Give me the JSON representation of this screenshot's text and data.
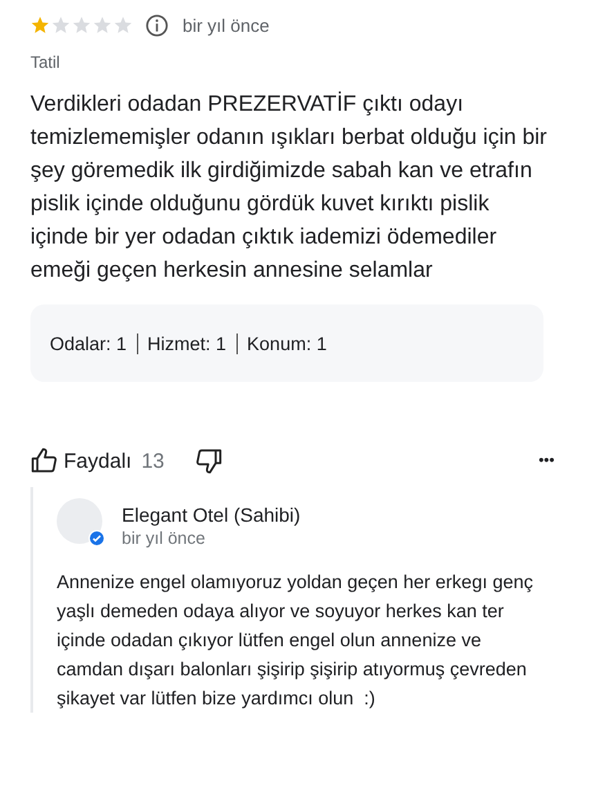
{
  "review": {
    "stars": 1,
    "time": "bir yıl önce",
    "trip_type": "Tatil",
    "text": "Verdikleri odadan PREZERVATİF çıktı odayı temizlememişler odanın ışıkları berbat olduğu için bir şey göremedik ilk girdiğimizde sabah kan ve etrafın pislik içinde olduğunu gördük kuvet kırıktı pislik içinde bir yer odadan çıktık iademizi ödemediler emeği geçen herkesin annesine selamlar",
    "ratings": [
      "Odalar: 1",
      "Hizmet: 1",
      "Konum: 1"
    ]
  },
  "actions": {
    "helpful_label": "Faydalı",
    "helpful_count": "13",
    "more": "•••"
  },
  "reply": {
    "author": "Elegant Otel (Sahibi)",
    "verified": true,
    "time": "bir yıl önce",
    "text": "Annenize engel olamıyoruz yoldan geçen her erkegı genç yaşlı demeden odaya alıyor ve soyuyor herkes kan ter içinde odadan çıkıyor lütfen engel olun annenize ve camdan dışarı balonları şişirip şişirip atıyormuş çevreden şikayet var lütfen bize yardımcı olun  :)"
  }
}
